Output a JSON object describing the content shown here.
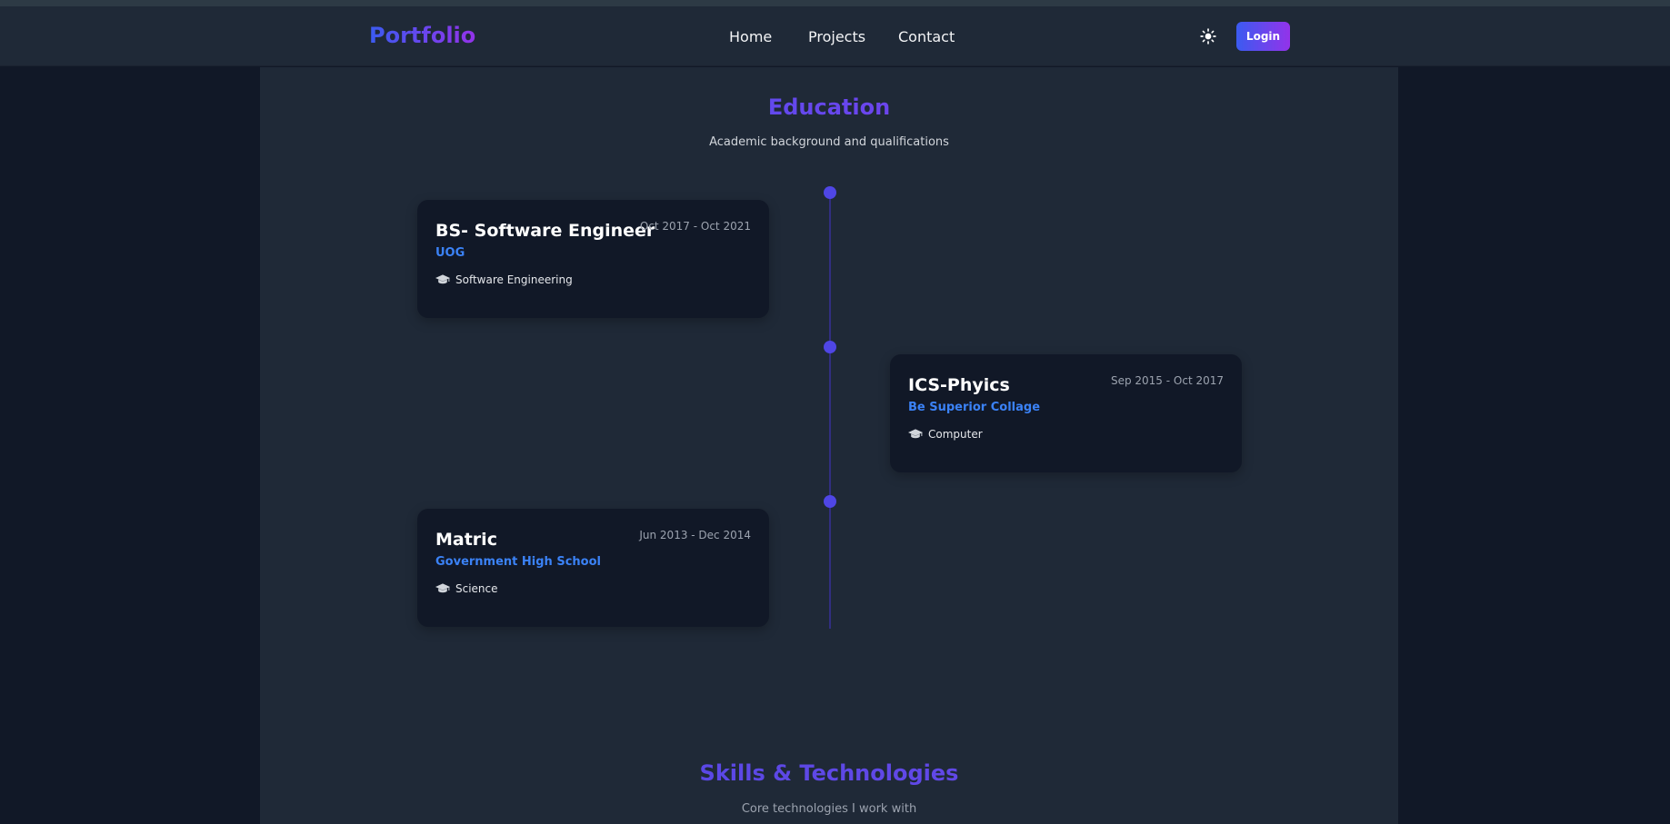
{
  "nav": {
    "brand": "Portfolio",
    "links": [
      "Home",
      "Projects",
      "Contact"
    ],
    "theme_icon": "sun-icon",
    "login_label": "Login"
  },
  "education": {
    "title": "Education",
    "subtitle": "Academic background and qualifications",
    "items": [
      {
        "degree": "BS- Software Engineer",
        "school": "UOG",
        "dates": "Oct 2017 - Oct 2021",
        "field": "Software Engineering",
        "icon": "graduation-cap-icon"
      },
      {
        "degree": "ICS-Phyics",
        "school": "Be Superior Collage",
        "dates": "Sep 2015 - Oct 2017",
        "field": "Computer",
        "icon": "graduation-cap-icon"
      },
      {
        "degree": "Matric",
        "school": "Government High School",
        "dates": "Jun 2013 - Dec 2014",
        "field": "Science",
        "icon": "graduation-cap-icon"
      }
    ]
  },
  "skills": {
    "title": "Skills & Technologies",
    "subtitle": "Core technologies I work with"
  },
  "colors": {
    "accent_start": "#3b5bf0",
    "accent_end": "#9333ea",
    "school_link": "#3b82f6",
    "timeline_dot": "#4f46e5",
    "card_bg": "#111827",
    "section_bg": "#1f2937"
  }
}
